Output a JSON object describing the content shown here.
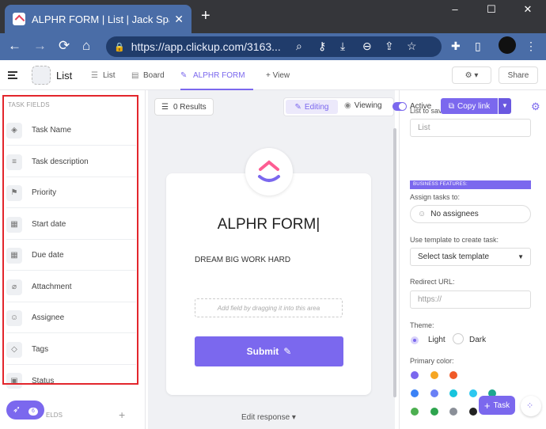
{
  "browser": {
    "tab_title": "ALPHR FORM | List | Jack Sparrow",
    "tab_close": "✕",
    "new_tab": "+",
    "win_controls": [
      "–",
      "☐",
      "✕"
    ],
    "url": "https://app.clickup.com/3163..."
  },
  "header": {
    "title": "List",
    "tabs": [
      {
        "label": "List"
      },
      {
        "label": "Board"
      },
      {
        "label": "ALPHR FORM"
      }
    ],
    "add_view": "+ View",
    "share": "Share"
  },
  "sidebar": {
    "heading": "TASK FIELDS",
    "fields": [
      {
        "label": "Task Name",
        "icon": "task-icon"
      },
      {
        "label": "Task description",
        "icon": "description-icon"
      },
      {
        "label": "Priority",
        "icon": "flag-icon"
      },
      {
        "label": "Start date",
        "icon": "calendar-icon"
      },
      {
        "label": "Due date",
        "icon": "calendar-icon"
      },
      {
        "label": "Attachment",
        "icon": "paperclip-icon"
      },
      {
        "label": "Assignee",
        "icon": "user-icon"
      },
      {
        "label": "Tags",
        "icon": "tag-icon"
      },
      {
        "label": "Status",
        "icon": "status-icon"
      }
    ],
    "custom_fields_fragment": "ELDS",
    "launcher_count": "6"
  },
  "toolbar": {
    "results": "0 Results",
    "editing": "Editing",
    "viewing": "Viewing",
    "active": "Active",
    "copy_link": "Copy link"
  },
  "form": {
    "title": "ALPHR FORM",
    "description": "DREAM BIG WORK HARD",
    "dropzone": "Add field by dragging it into this area",
    "submit": "Submit",
    "edit_response": "Edit response ▾"
  },
  "settings": {
    "list_label": "List to save tasks:",
    "list_placeholder": "List",
    "business": "BUSINESS FEATURES:",
    "assign_label": "Assign tasks to:",
    "assign_value": "No assignees",
    "template_label": "Use template to create task:",
    "template_value": "Select task template",
    "redirect_label": "Redirect URL:",
    "redirect_placeholder": "https://",
    "theme_label": "Theme:",
    "theme_light": "Light",
    "theme_dark": "Dark",
    "primary_label": "Primary color:",
    "colors": [
      "#7b68ee",
      "#f5a623",
      "#f05a28",
      "#3b82f6",
      "#6a80f6",
      "#17c4dd",
      "#2dc7f0",
      "#1ea78f",
      "#4caf50",
      "#2da44e",
      "#8a8f98",
      "#222222"
    ]
  },
  "task_button": "Task"
}
